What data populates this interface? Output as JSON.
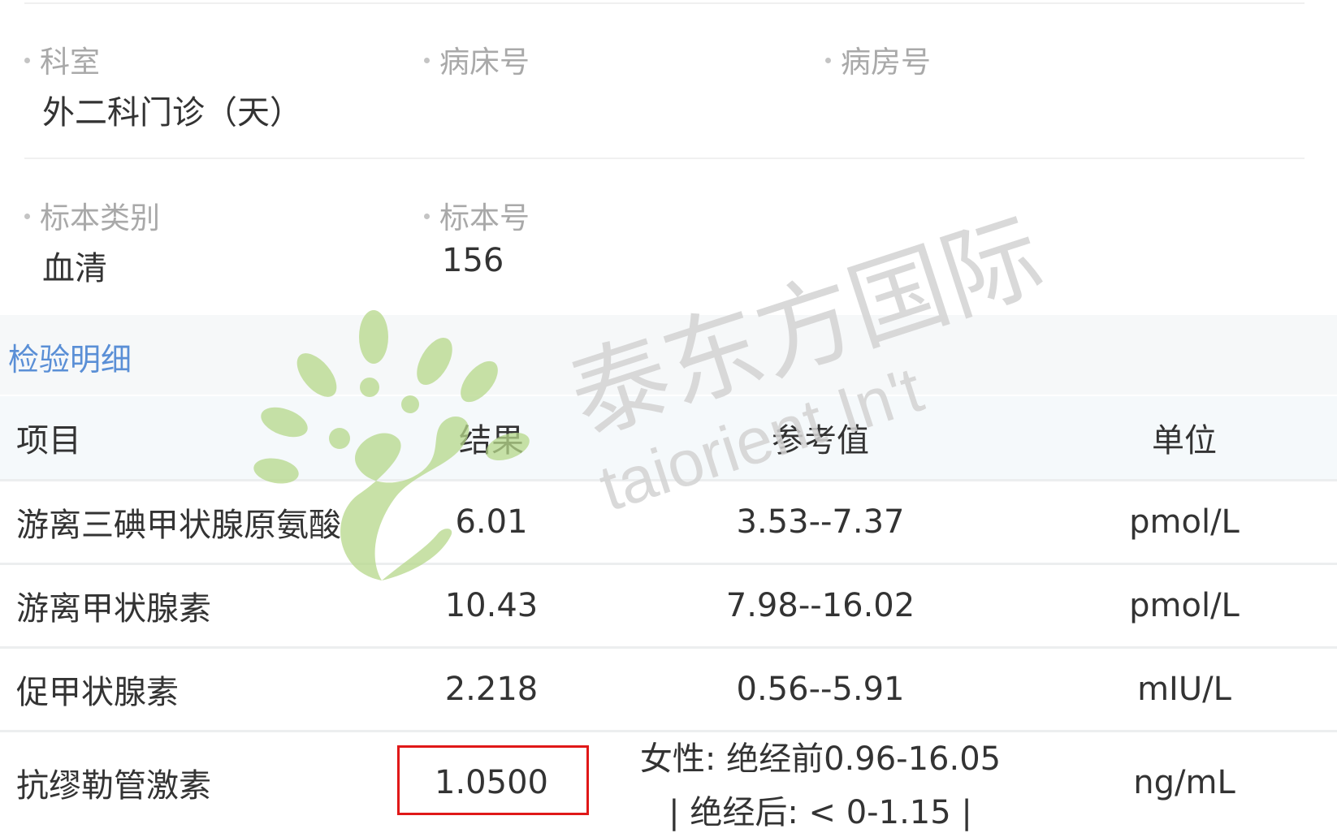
{
  "info": {
    "row1": [
      {
        "label": "科室",
        "value": "外二科门诊（天）"
      },
      {
        "label": "病床号",
        "value": ""
      },
      {
        "label": "病房号",
        "value": ""
      }
    ],
    "row2": [
      {
        "label": "标本类别",
        "value": "血清"
      },
      {
        "label": "标本号",
        "value": "156"
      }
    ]
  },
  "section_title": "检验明细",
  "table": {
    "headers": [
      "项目",
      "结果",
      "参考值",
      "单位"
    ],
    "rows": [
      {
        "item": "游离三碘甲状腺原氨酸",
        "result": "6.01",
        "reference": "3.53--7.37",
        "reference_line2": "",
        "unit": "pmol/L"
      },
      {
        "item": "游离甲状腺素",
        "result": "10.43",
        "reference": "7.98--16.02",
        "reference_line2": "",
        "unit": "pmol/L"
      },
      {
        "item": "促甲状腺素",
        "result": "2.218",
        "reference": "0.56--5.91",
        "reference_line2": "",
        "unit": "mIU/L"
      },
      {
        "item": "抗缪勒管激素",
        "result": "1.0500",
        "reference": "女性: 绝经前0.96-16.05",
        "reference_line2": "| 绝经后: < 0-1.15 |",
        "unit": "ng/mL"
      }
    ]
  },
  "watermark": {
    "brand_cn": "泰东方国际",
    "brand_en": "taiorient In't",
    "logo_color": "#b6d88a",
    "text_color": "#d3d3d3"
  },
  "highlight_color": "#e01818"
}
